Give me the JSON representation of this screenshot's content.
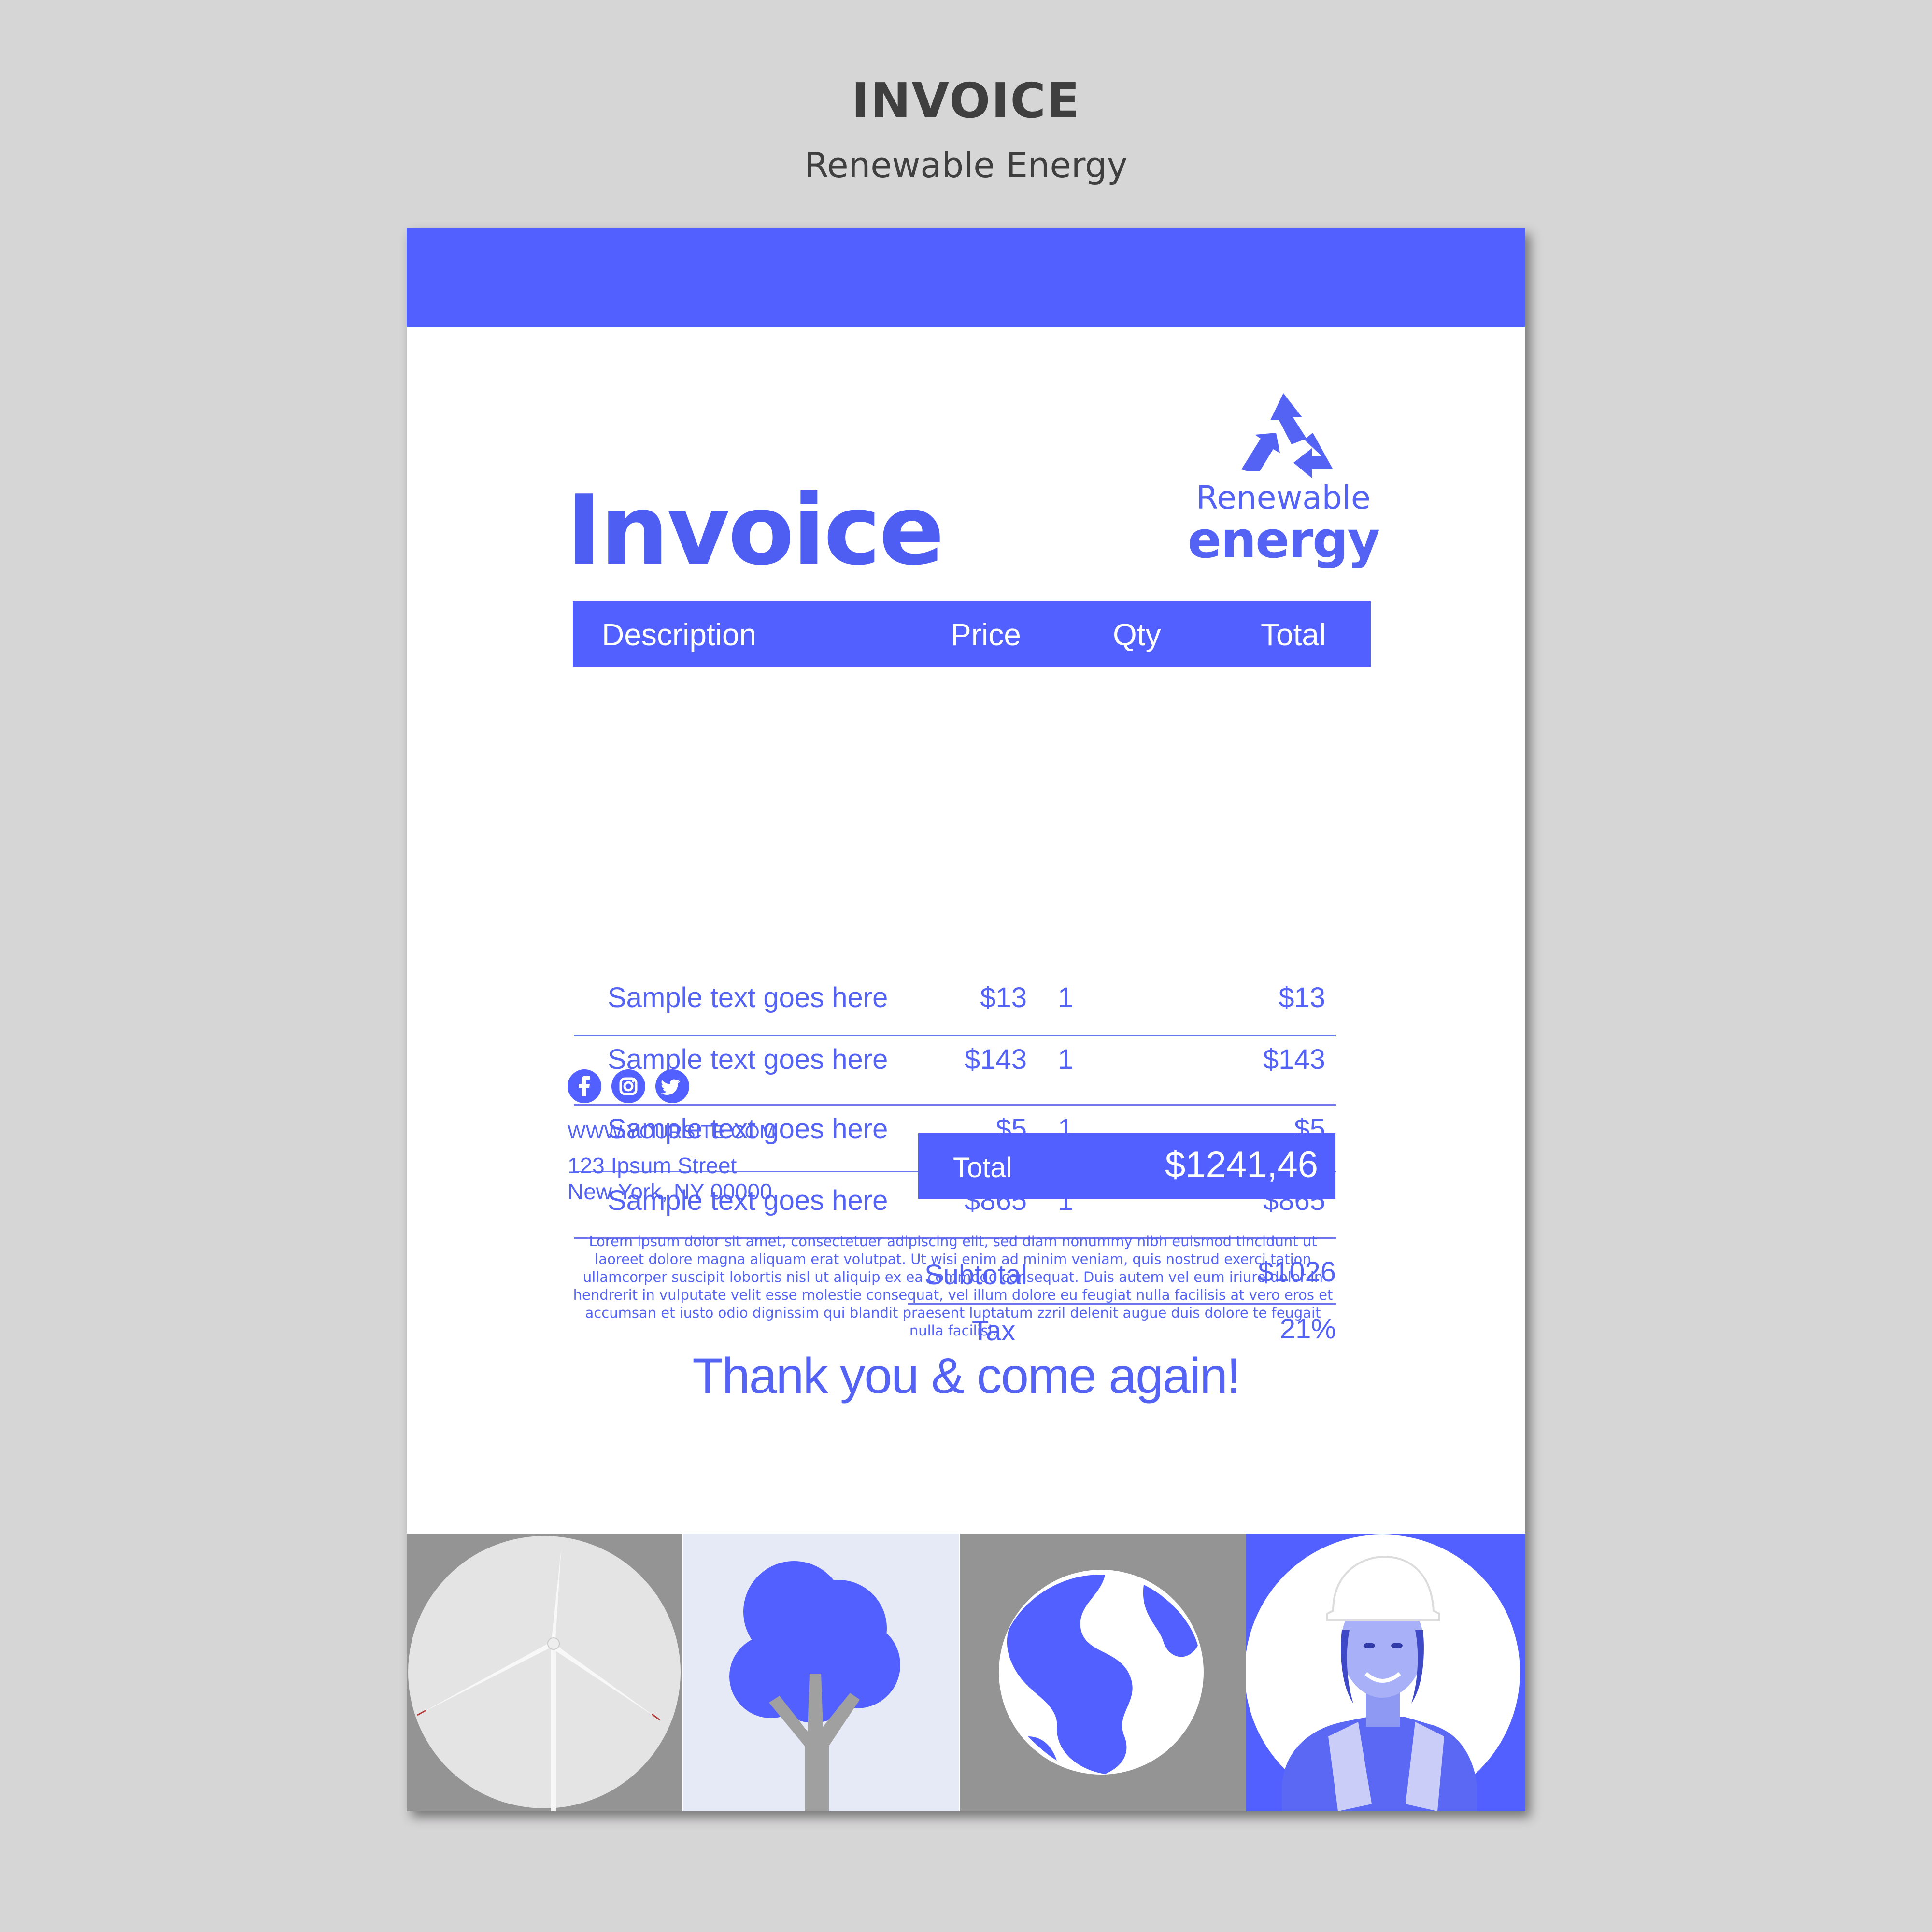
{
  "header": {
    "title": "INVOICE",
    "subtitle": "Renewable Energy"
  },
  "invoice": {
    "title": "Invoice",
    "logo": {
      "line1": "Renewable",
      "line2": "energy",
      "icon": "recycle-icon"
    },
    "columns": {
      "description": "Description",
      "price": "Price",
      "qty": "Qty",
      "total": "Total"
    },
    "items": [
      {
        "description": "Sample text goes here",
        "price": "$13",
        "qty": "1",
        "total": "$13"
      },
      {
        "description": "Sample text goes here",
        "price": "$143",
        "qty": "1",
        "total": "$143"
      },
      {
        "description": "Sample text goes here",
        "price": "$5",
        "qty": "1",
        "total": "$5"
      },
      {
        "description": "Sample text goes here",
        "price": "$865",
        "qty": "1",
        "total": "$865"
      }
    ],
    "summary": {
      "subtotal_label": "Subtotal",
      "subtotal_value": "$1026",
      "tax_label": "Tax",
      "tax_value": "21%",
      "total_label": "Total",
      "total_value": "$1241,46"
    },
    "contact": {
      "social_icons": [
        "facebook-icon",
        "instagram-icon",
        "twitter-icon"
      ],
      "website": "WWW.YOURSITE.COM",
      "address_line1": "123 Ipsum Street",
      "address_line2": "New York, NY 00000"
    },
    "lorem": "Lorem ipsum dolor sit amet, consectetuer adipiscing elit, sed diam nonummy nibh euismod tincidunt ut laoreet dolore magna aliquam erat volutpat. Ut wisi enim ad minim veniam, quis nostrud exerci tation ullamcorper suscipit lobortis nisl ut aliquip ex ea commodo consequat. Duis autem vel eum iriure dolor in hendrerit in vulputate velit esse molestie consequat, vel illum dolore eu feugiat nulla facilisis at vero eros et accumsan et iusto odio dignissim qui blandit praesent luptatum zzril delenit augue duis dolore te feugait nulla facilisi.",
    "thanks": "Thank you & come again!"
  },
  "bottom_images": [
    "wind-turbine-image",
    "tree-image",
    "globe-image",
    "worker-portrait-image"
  ],
  "colors": {
    "accent": "#5260ff",
    "text_accent": "#5563f5",
    "background": "#d7d6d7",
    "paper": "#ffffff"
  }
}
